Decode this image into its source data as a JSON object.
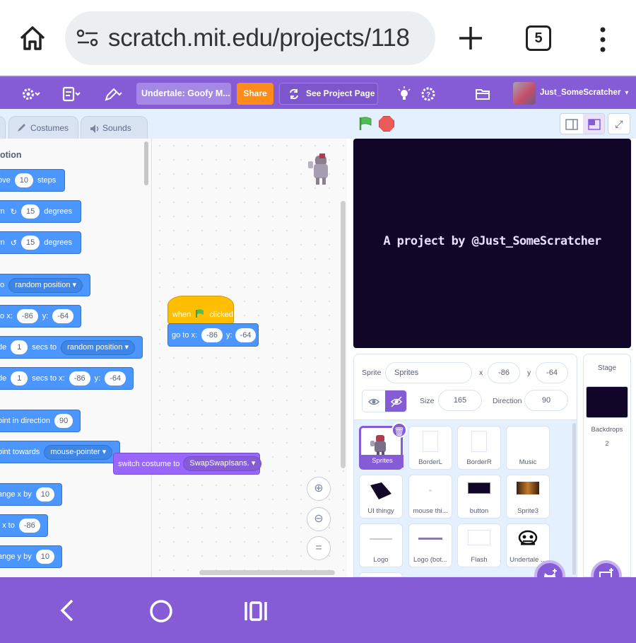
{
  "browser": {
    "url": "scratch.mit.edu/projects/118",
    "tab_count": "5"
  },
  "menubar": {
    "project_title": "Undertale: Goofy M...",
    "share_label": "Share",
    "see_project_label": "See Project Page",
    "username": "Just_SomeScratcher"
  },
  "tabs": {
    "costumes": "Costumes",
    "sounds": "Sounds"
  },
  "palette": {
    "category": "otion",
    "blocks": [
      {
        "pre": "ove",
        "v1": "10",
        "post": "steps"
      },
      {
        "pre": "rn",
        "icon": "↻",
        "v1": "15",
        "post": "degrees"
      },
      {
        "pre": "rn",
        "icon": "↺",
        "v1": "15",
        "post": "degrees"
      },
      {
        "pre": "to",
        "dd": "random position"
      },
      {
        "pre": "to x:",
        "v1": "-86",
        "mid": "y:",
        "v2": "-64"
      },
      {
        "pre": "de",
        "v1": "1",
        "mid": "secs to",
        "dd": "random position"
      },
      {
        "pre": "de",
        "v1": "1",
        "mid": "secs to x:",
        "v2": "-86",
        "mid2": "y:",
        "v3": "-64"
      },
      {
        "pre": "oint in direction",
        "v1": "90"
      },
      {
        "pre": "oint towards",
        "dd": "mouse-pointer"
      },
      {
        "pre": "ange x by",
        "v1": "10"
      },
      {
        "pre": "t x to",
        "v1": "-86"
      },
      {
        "pre": "ange y by",
        "v1": "10"
      }
    ]
  },
  "script": {
    "hat_when": "when",
    "hat_clicked": "clicked",
    "goto_label": "go to x:",
    "goto_x": "-86",
    "goto_y_label": "y:",
    "goto_y": "-64",
    "drag_label": "switch costume to",
    "drag_value": "SwapSwapIsans."
  },
  "stage": {
    "text": "A project by @Just_SomeScratcher"
  },
  "sprite_info": {
    "sprite_label": "Sprite",
    "sprite_name": "Sprites",
    "x_label": "x",
    "x_value": "-86",
    "y_label": "y",
    "y_value": "-64",
    "size_label": "Size",
    "size_value": "165",
    "direction_label": "Direction",
    "direction_value": "90"
  },
  "sprites": [
    {
      "name": "Sprites",
      "selected": true
    },
    {
      "name": "BorderL"
    },
    {
      "name": "BorderR"
    },
    {
      "name": "Music"
    },
    {
      "name": "UI thingy"
    },
    {
      "name": "mouse thi..."
    },
    {
      "name": "button"
    },
    {
      "name": "Sprite3"
    },
    {
      "name": "Logo"
    },
    {
      "name": "Logo (bot..."
    },
    {
      "name": "Flash"
    },
    {
      "name": "Undertale ..."
    }
  ],
  "stage_pane": {
    "title": "Stage",
    "backdrops_label": "Backdrops",
    "backdrops_count": "2"
  },
  "colors": {
    "scratch_purple": "#855cd6",
    "motion_blue": "#4c97ff",
    "events_yellow": "#ffbf00",
    "looks_purple": "#9966ff",
    "share_orange": "#ff8c1a",
    "stage_bg": "#110628"
  }
}
